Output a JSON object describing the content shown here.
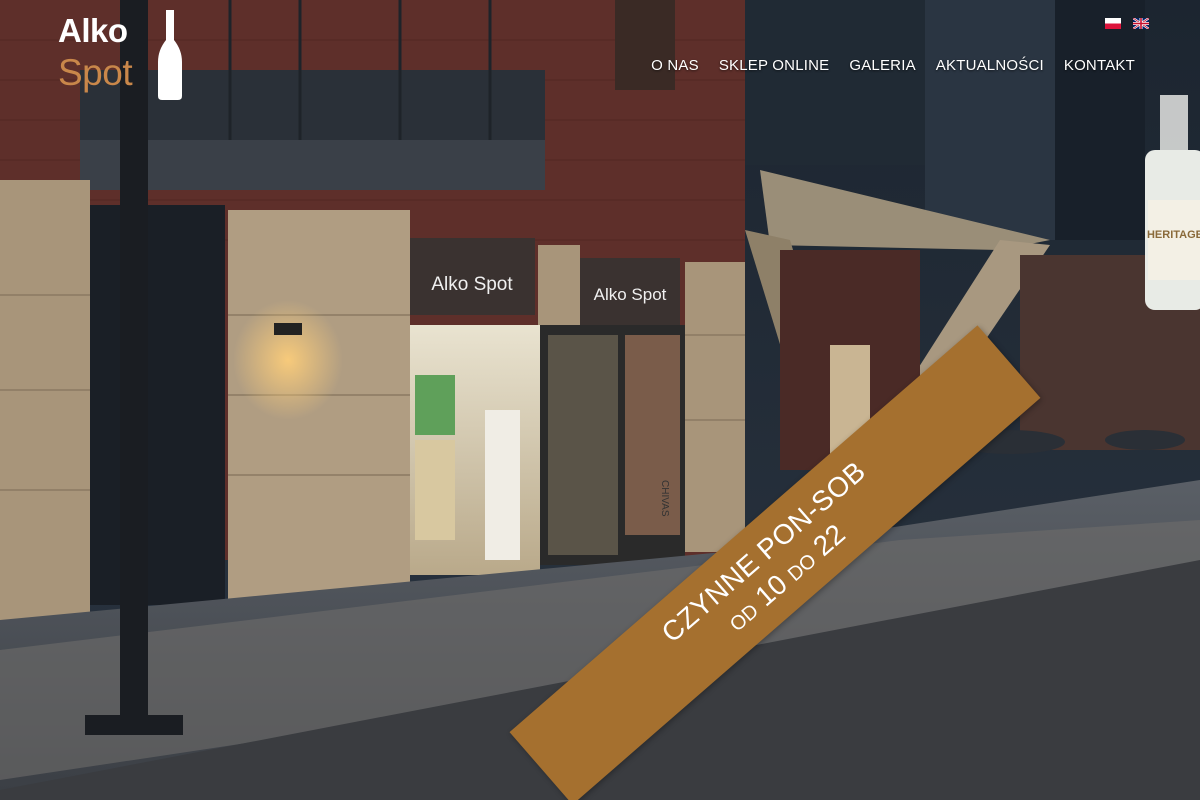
{
  "logo": {
    "line1": "Alko",
    "line2": "Spot"
  },
  "nav": {
    "items": [
      {
        "label": "O NAS"
      },
      {
        "label": "SKLEP ONLINE"
      },
      {
        "label": "GALERIA"
      },
      {
        "label": "AKTUALNOŚCI"
      },
      {
        "label": "KONTAKT"
      }
    ]
  },
  "languages": [
    {
      "code": "pl",
      "icon": "flag-poland-icon"
    },
    {
      "code": "en",
      "icon": "flag-uk-icon"
    }
  ],
  "signs": {
    "left": "Alko Spot",
    "right": "Alko Spot"
  },
  "bottle_label": "HERITAGE",
  "storefront_label": "CHIVAS",
  "hours_banner": {
    "line1": "CZYNNE PON-SOB",
    "od": "OD",
    "from": "10",
    "do": "DO",
    "to": "22"
  },
  "colors": {
    "accent": "#a5702f",
    "logo_orange": "#c9874a",
    "text": "#ffffff"
  }
}
